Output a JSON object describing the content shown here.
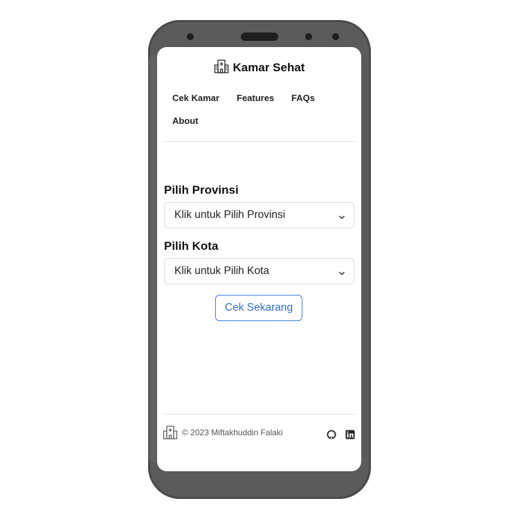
{
  "app": {
    "brand_name": "Kamar Sehat",
    "brand_icon": "hospital-icon"
  },
  "nav": {
    "items": [
      {
        "label": "Cek Kamar"
      },
      {
        "label": "Features"
      },
      {
        "label": "FAQs"
      },
      {
        "label": "About"
      }
    ]
  },
  "form": {
    "province_label": "Pilih Provinsi",
    "province_value": "Klik untuk Pilih Provinsi",
    "city_label": "Pilih Kota",
    "city_value": "Klik untuk Pilih Kota",
    "submit_label": "Cek Sekarang"
  },
  "footer": {
    "copyright": "© 2023 Miftakhuddin Falaki",
    "icons": [
      "hospital-icon",
      "github-icon",
      "linkedin-icon"
    ]
  },
  "colors": {
    "accent": "#2f6fd6",
    "phone_body": "#5b5b5b",
    "text": "#111111"
  }
}
